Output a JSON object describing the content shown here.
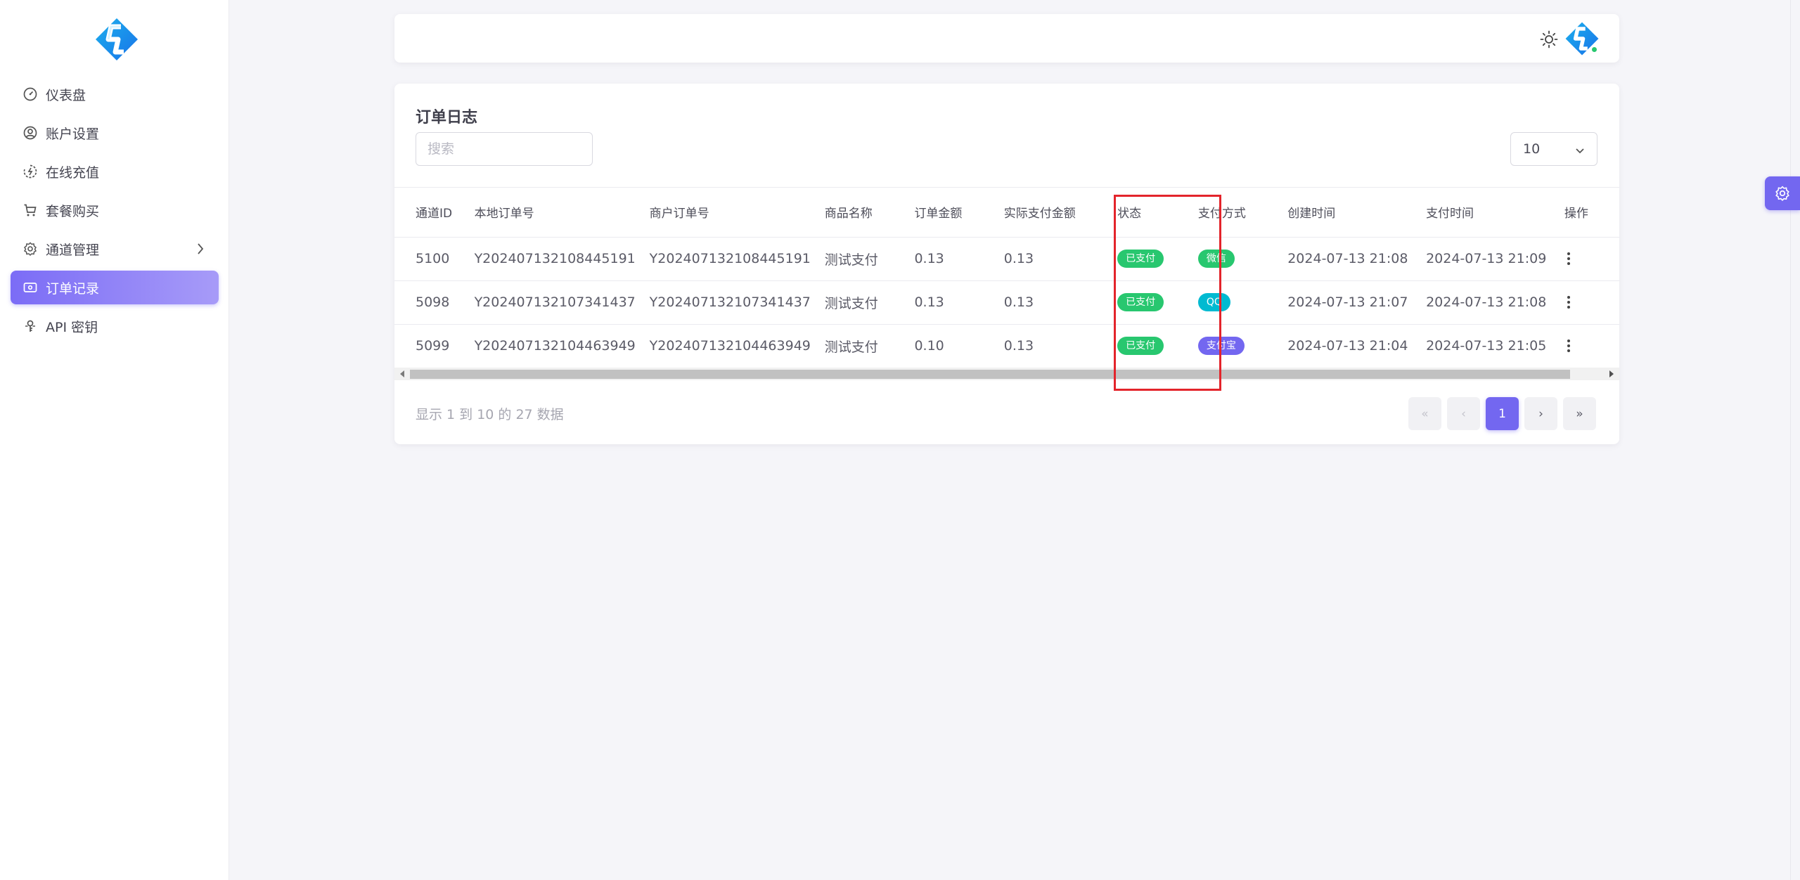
{
  "sidebar": {
    "items": [
      {
        "label": "仪表盘",
        "icon": "dashboard-icon"
      },
      {
        "label": "账户设置",
        "icon": "user-circle-icon"
      },
      {
        "label": "在线充值",
        "icon": "recharge-icon"
      },
      {
        "label": "套餐购买",
        "icon": "cart-icon"
      },
      {
        "label": "通道管理",
        "icon": "settings-icon"
      },
      {
        "label": "订单记录",
        "icon": "cash-icon"
      },
      {
        "label": "API 密钥",
        "icon": "key-icon"
      }
    ],
    "active_index": 5
  },
  "card": {
    "title": "订单日志",
    "search_placeholder": "搜索",
    "page_size": "10",
    "columns": [
      "通道ID",
      "本地订单号",
      "商户订单号",
      "商品名称",
      "订单金额",
      "实际支付金额",
      "状态",
      "支付方式",
      "创建时间",
      "支付时间",
      "操作"
    ],
    "rows": [
      {
        "channel_id": "5100",
        "local_no": "Y202407132108445191",
        "merchant_no": "Y202407132108445191",
        "product": "测试支付",
        "amount": "0.13",
        "paid": "0.13",
        "status": "已支付",
        "method": "微信",
        "created": "2024-07-13 21:08",
        "paid_time": "2024-07-13 21:09"
      },
      {
        "channel_id": "5098",
        "local_no": "Y202407132107341437",
        "merchant_no": "Y202407132107341437",
        "product": "测试支付",
        "amount": "0.13",
        "paid": "0.13",
        "status": "已支付",
        "method": "QQ",
        "created": "2024-07-13 21:07",
        "paid_time": "2024-07-13 21:08"
      },
      {
        "channel_id": "5099",
        "local_no": "Y202407132104463949",
        "merchant_no": "Y202407132104463949",
        "product": "测试支付",
        "amount": "0.10",
        "paid": "0.13",
        "status": "已支付",
        "method": "支付宝",
        "created": "2024-07-13 21:04",
        "paid_time": "2024-07-13 21:05"
      }
    ],
    "footer_info": "显示 1 到 10 的 27 数据",
    "pagination": {
      "current": "1",
      "first": "«",
      "prev": "‹",
      "next": "›",
      "last": "»"
    }
  },
  "colors": {
    "accent": "#7367f0",
    "status_paid": "#28c76f",
    "method_wechat": "#28c76f",
    "method_qq": "#00bad1",
    "method_alipay": "#7367f0",
    "highlight": "#e3242b"
  }
}
